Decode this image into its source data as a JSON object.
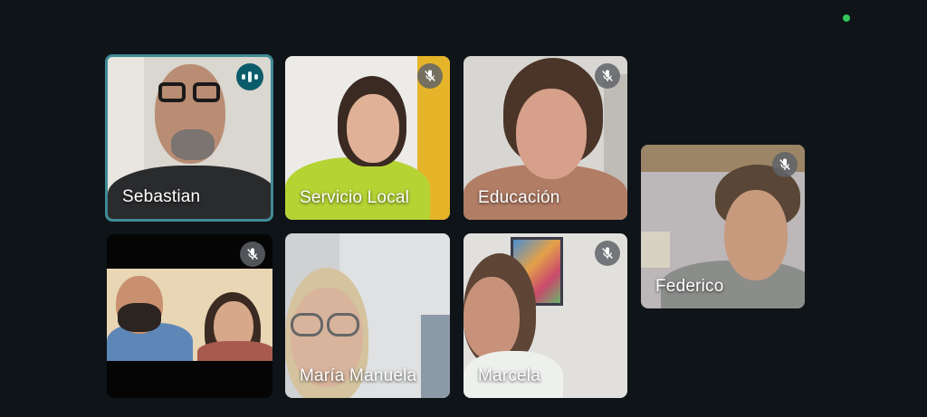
{
  "participants": [
    {
      "name": "Sebastian",
      "mic": "speaking"
    },
    {
      "name": "Servicio Local",
      "mic": "muted"
    },
    {
      "name": "Educación",
      "mic": "muted"
    },
    {
      "name": "Federico",
      "mic": "muted"
    },
    {
      "name": "",
      "mic": "muted"
    },
    {
      "name": "María Manuela",
      "mic": ""
    },
    {
      "name": "Marcela",
      "mic": "muted"
    }
  ],
  "status_indicator": {
    "color": "#34c759",
    "icon": "recording-dot"
  },
  "colors": {
    "background": "#0f1418",
    "active_border": "#3f8a96",
    "speaking_badge": "#0b5c6b"
  }
}
